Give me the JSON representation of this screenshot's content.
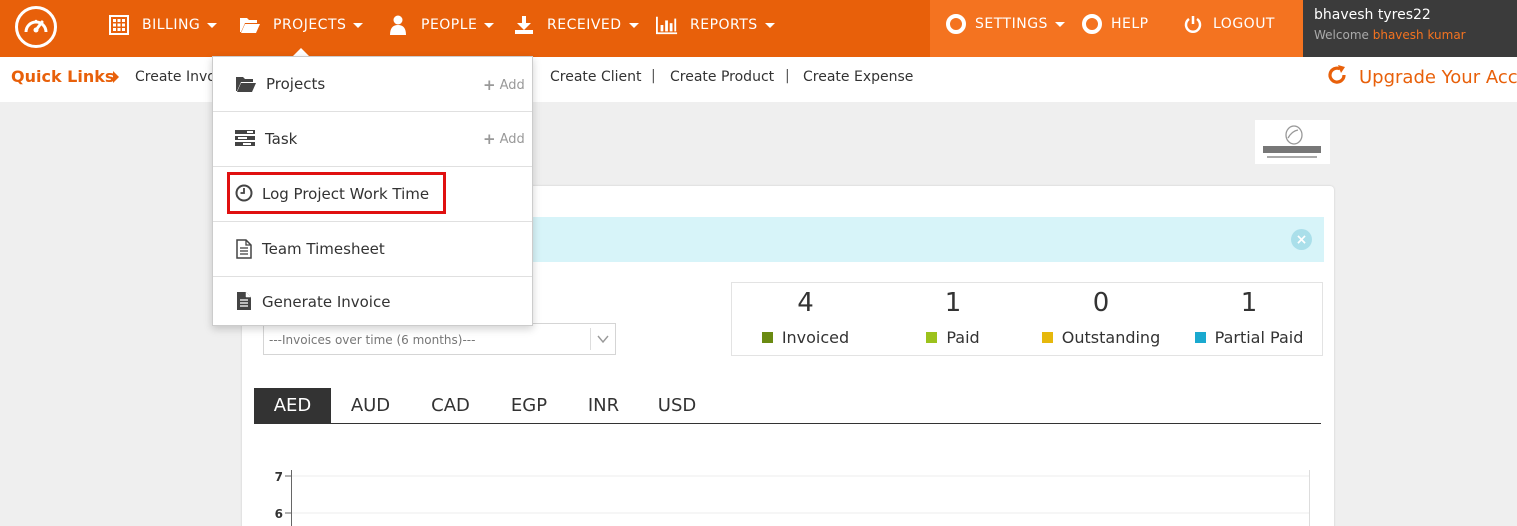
{
  "nav": {
    "items": [
      {
        "label": "BILLING"
      },
      {
        "label": "PROJECTS"
      },
      {
        "label": "PEOPLE"
      },
      {
        "label": "RECEIVED"
      },
      {
        "label": "REPORTS"
      }
    ],
    "settings": "SETTINGS",
    "help": "HELP",
    "logout": "LOGOUT",
    "user": {
      "name": "bhavesh tyres22",
      "welcome": "Welcome",
      "display_name": "bhavesh kumar"
    }
  },
  "quick_links": {
    "title": "Quick Links",
    "links": [
      "Create Invo",
      "Create Client",
      "Create Product",
      "Create Expense"
    ],
    "separator": "|",
    "upgrade": "Upgrade Your Acc"
  },
  "dropdown": {
    "items": [
      {
        "label": "Projects",
        "add": "Add",
        "icon": "folder-open-icon"
      },
      {
        "label": "Task",
        "add": "Add",
        "icon": "tasks-icon"
      },
      {
        "label": "Log Project Work Time",
        "icon": "clock-icon",
        "highlighted": true
      },
      {
        "label": "Team Timesheet",
        "icon": "document-icon"
      },
      {
        "label": "Generate Invoice",
        "icon": "file-text-icon"
      }
    ]
  },
  "dashboard": {
    "period_select": "---Invoices over time (6 months)---",
    "stats": [
      {
        "value": "4",
        "label": "Invoiced",
        "color": "#6a8a12"
      },
      {
        "value": "1",
        "label": "Paid",
        "color": "#9cc21c"
      },
      {
        "value": "0",
        "label": "Outstanding",
        "color": "#e6b80c"
      },
      {
        "value": "1",
        "label": "Partial Paid",
        "color": "#1aa9cf"
      }
    ],
    "currencies": [
      "AED",
      "AUD",
      "CAD",
      "EGP",
      "INR",
      "USD"
    ],
    "active_currency": "AED",
    "axis_ticks": [
      "7",
      "6"
    ]
  },
  "colors": {
    "brand": "#e8600a",
    "brand_light": "#f47320",
    "dark": "#3b3b3b"
  }
}
